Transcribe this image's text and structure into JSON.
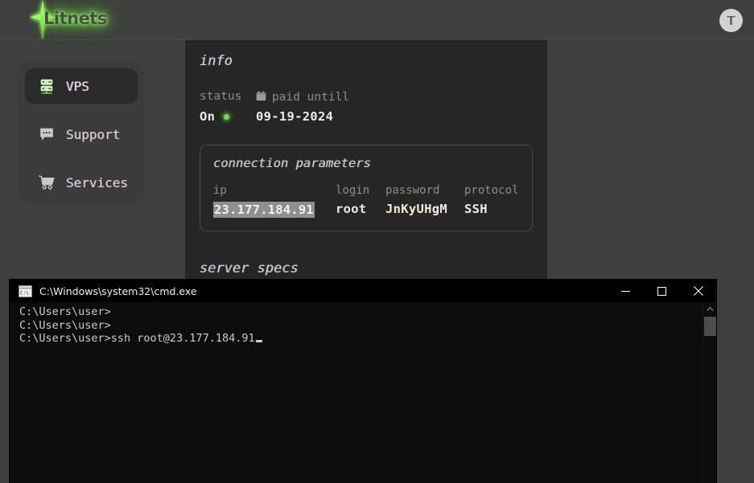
{
  "header": {
    "logo_text": "Litnets",
    "logo_icon": "sparkle-star-icon",
    "avatar_letter": "T"
  },
  "sidebar": {
    "items": [
      {
        "label": "VPS",
        "icon": "server-rack-icon",
        "active": true
      },
      {
        "label": "Support",
        "icon": "chat-bubble-icon",
        "active": false
      },
      {
        "label": "Services",
        "icon": "shopping-cart-icon",
        "active": false
      }
    ]
  },
  "main": {
    "info_title": "info",
    "status_label": "status",
    "status_value": "On",
    "paid_until_label": "paid untill",
    "paid_until_value": "09-19-2024",
    "calendar_icon": "calendar-icon",
    "status_dot_color": "#6fdc4a",
    "connection": {
      "title": "connection parameters",
      "headers": [
        "ip",
        "login",
        "password",
        "protocol"
      ],
      "values": [
        "23.177.184.91",
        "root",
        "JnKyUHgM",
        "SSH"
      ]
    },
    "specs_title": "server specs"
  },
  "cmd": {
    "title": "C:\\Windows\\system32\\cmd.exe",
    "icon": "cmd-console-icon",
    "minimize_label": "─",
    "maximize_label": "□",
    "close_label": "✕",
    "lines": [
      "C:\\Users\\user>",
      "C:\\Users\\user>",
      "C:\\Users\\user>ssh root@23.177.184.91"
    ]
  }
}
